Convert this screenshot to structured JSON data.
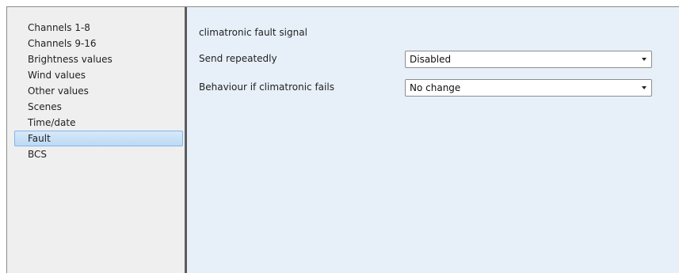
{
  "sidebar": {
    "items": [
      {
        "label": "Channels 1-8"
      },
      {
        "label": "Channels 9-16"
      },
      {
        "label": "Brightness values"
      },
      {
        "label": "Wind values"
      },
      {
        "label": "Other values"
      },
      {
        "label": "Scenes"
      },
      {
        "label": "Time/date"
      },
      {
        "label": "Fault",
        "selected": true
      },
      {
        "label": "BCS"
      }
    ]
  },
  "content": {
    "section_title": "climatronic fault signal",
    "params": [
      {
        "label": "Send repeatedly",
        "value": "Disabled",
        "icon": "chevron-down-icon"
      },
      {
        "label": "Behaviour if climatronic fails",
        "value": "No change",
        "icon": "chevron-down-icon"
      }
    ]
  },
  "colors": {
    "sidebar_bg": "#efeff0",
    "content_bg": "#e7f0f8",
    "selection": "#bcdaf5",
    "divider": "#5b5b5b"
  }
}
